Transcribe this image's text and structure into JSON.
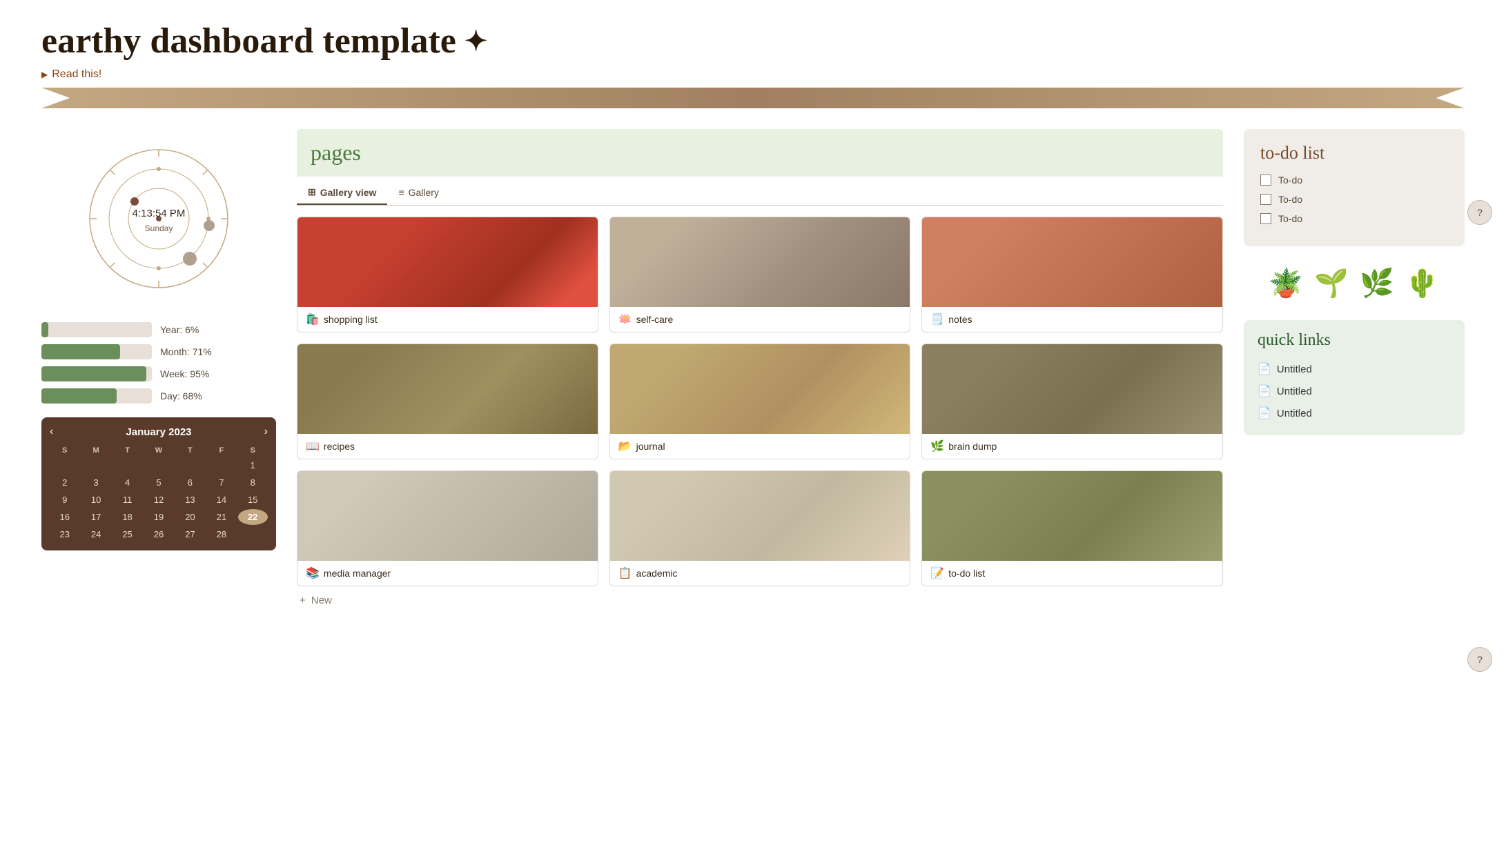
{
  "header": {
    "title": "earthy dashboard template",
    "sparkle": "✦",
    "read_this_label": "Read this!"
  },
  "clock": {
    "time": "4:13:54 PM",
    "day": "Sunday"
  },
  "progress": {
    "items": [
      {
        "label": "Year: 6%",
        "value": 6
      },
      {
        "label": "Month: 71%",
        "value": 71
      },
      {
        "label": "Week: 95%",
        "value": 95
      },
      {
        "label": "Day: 68%",
        "value": 68
      }
    ]
  },
  "calendar": {
    "month_year": "January 2023",
    "prev": "‹",
    "next": "›",
    "day_headers": [
      "S",
      "M",
      "T",
      "W",
      "T",
      "F",
      "S"
    ],
    "days": [
      {
        "d": "",
        "empty": true
      },
      {
        "d": "",
        "empty": true
      },
      {
        "d": "",
        "empty": true
      },
      {
        "d": "",
        "empty": true
      },
      {
        "d": "",
        "empty": true
      },
      {
        "d": "",
        "empty": true
      },
      {
        "d": "1"
      },
      {
        "d": "2"
      },
      {
        "d": "3"
      },
      {
        "d": "4"
      },
      {
        "d": "5"
      },
      {
        "d": "6"
      },
      {
        "d": "7"
      },
      {
        "d": "8"
      },
      {
        "d": "9"
      },
      {
        "d": "10"
      },
      {
        "d": "11"
      },
      {
        "d": "12"
      },
      {
        "d": "13"
      },
      {
        "d": "14"
      },
      {
        "d": "15"
      },
      {
        "d": "16"
      },
      {
        "d": "17"
      },
      {
        "d": "18"
      },
      {
        "d": "19"
      },
      {
        "d": "20"
      },
      {
        "d": "21"
      },
      {
        "d": "22",
        "today": true
      },
      {
        "d": "23"
      },
      {
        "d": "24"
      },
      {
        "d": "25"
      },
      {
        "d": "26"
      },
      {
        "d": "27"
      },
      {
        "d": "28"
      },
      {
        "d": ""
      }
    ]
  },
  "pages": {
    "title": "pages",
    "tabs": [
      {
        "label": "Gallery view",
        "active": true
      },
      {
        "label": "Gallery",
        "active": false
      }
    ],
    "cards": [
      {
        "label": "shopping list",
        "emoji": "🛍️",
        "img_class": "img-strawberry"
      },
      {
        "label": "self-care",
        "emoji": "🪷",
        "img_class": "img-book"
      },
      {
        "label": "notes",
        "emoji": "🗒️",
        "img_class": "img-peaches"
      },
      {
        "label": "recipes",
        "emoji": "📖",
        "img_class": "img-recipes"
      },
      {
        "label": "journal",
        "emoji": "📂",
        "img_class": "img-journal"
      },
      {
        "label": "brain dump",
        "emoji": "🌿",
        "img_class": "img-braindump"
      },
      {
        "label": "media manager",
        "emoji": "📚",
        "img_class": "img-media"
      },
      {
        "label": "academic",
        "emoji": "📋",
        "img_class": "img-academic"
      },
      {
        "label": "to-do list",
        "emoji": "📝",
        "img_class": "img-todolist"
      }
    ],
    "add_new": "New"
  },
  "todo": {
    "title": "to-do list",
    "items": [
      {
        "label": "To-do"
      },
      {
        "label": "To-do"
      },
      {
        "label": "To-do"
      }
    ]
  },
  "plants": {
    "emojis": [
      "🪴",
      "🌱",
      "🌿",
      "🌵"
    ]
  },
  "quick_links": {
    "title": "quick links",
    "items": [
      {
        "label": "Untitled"
      },
      {
        "label": "Untitled"
      },
      {
        "label": "Untitled"
      }
    ]
  },
  "help": {
    "label": "?"
  }
}
